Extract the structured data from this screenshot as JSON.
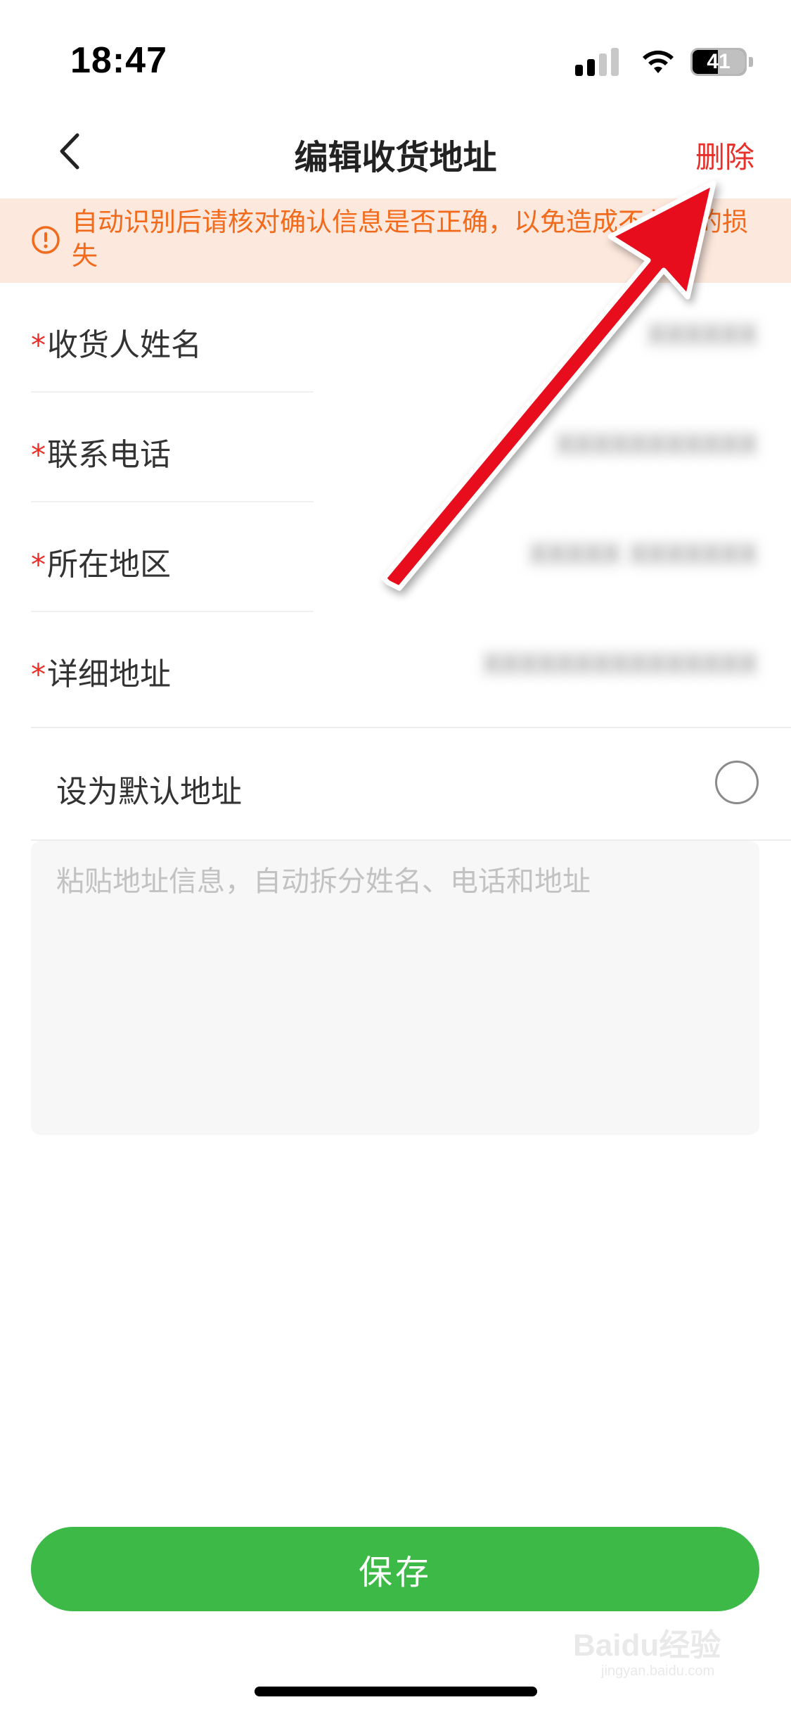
{
  "status_bar": {
    "time": "18:47",
    "battery_level": "41",
    "icons": [
      "signal-icon",
      "wifi-icon",
      "battery-icon"
    ]
  },
  "nav": {
    "title": "编辑收货地址",
    "delete_label": "删除",
    "back_icon": "chevron-left-icon"
  },
  "warning": {
    "text": "自动识别后请核对确认信息是否正确，以免造成不必要的损失",
    "icon": "alert-circle-icon"
  },
  "form": {
    "required_mark": "*",
    "fields": [
      {
        "label": "收货人姓名",
        "value": "XXXXXX"
      },
      {
        "label": "联系电话",
        "value": "XXXXXXXXXXX"
      },
      {
        "label": "所在地区",
        "value": "XXXXX XXXXXXX"
      },
      {
        "label": "详细地址",
        "value": "XXXXXXXXXXXXXXX"
      }
    ],
    "default_label": "设为默认地址",
    "default_checked": false
  },
  "paste": {
    "placeholder": "粘贴地址信息，自动拆分姓名、电话和地址"
  },
  "save_label": "保存",
  "watermark": {
    "text": "Baidu经验",
    "sub": "jingyan.baidu.com"
  },
  "colors": {
    "accent_red": "#e8302a",
    "warning_orange": "#f26a1b",
    "warning_bg": "#fde8dd",
    "save_green": "#3cb947",
    "annotation_arrow": "#e8101a"
  }
}
